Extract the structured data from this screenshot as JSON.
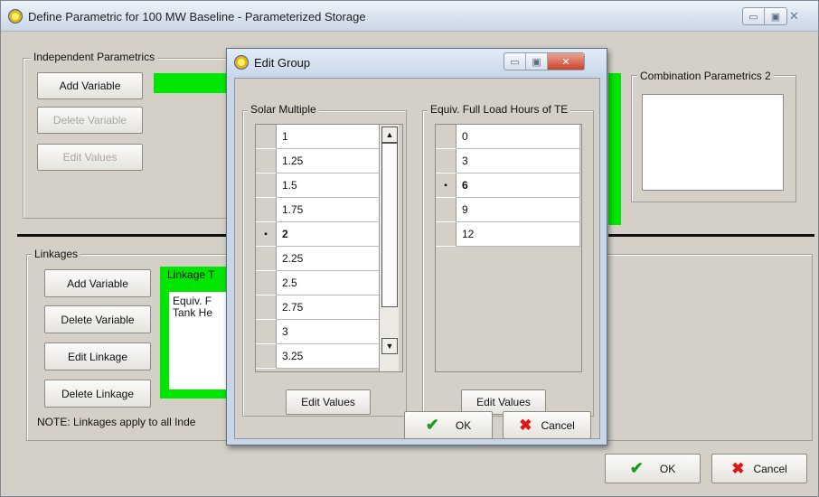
{
  "main_window": {
    "title": "Define Parametric for 100 MW Baseline - Parameterized Storage",
    "icon": "sun-app-icon",
    "independent": {
      "label": "Independent Parametrics",
      "add_variable": "Add Variable",
      "delete_variable": "Delete Variable",
      "edit_values": "Edit Values"
    },
    "combination_2_label": "Combination Parametrics 2",
    "linkages": {
      "label": "Linkages",
      "add_variable": "Add Variable",
      "delete_variable": "Delete Variable",
      "edit_linkage": "Edit Linkage",
      "delete_linkage": "Delete Linkage",
      "table_header": "Linkage T",
      "items": [
        "Equiv. F",
        "Tank He"
      ],
      "note": "NOTE: Linkages apply to all Inde"
    },
    "ok": "OK",
    "cancel": "Cancel"
  },
  "dialog": {
    "title": "Edit Group",
    "left_group": {
      "label": "Solar Multiple",
      "values": [
        "1",
        "1.25",
        "1.5",
        "1.75",
        "2",
        "2.25",
        "2.5",
        "2.75",
        "3",
        "3.25"
      ],
      "current_index": 4,
      "current_marker": "▪",
      "edit_values": "Edit Values"
    },
    "right_group": {
      "label": "Equiv. Full Load Hours of TE",
      "values": [
        "0",
        "3",
        "6",
        "9",
        "12"
      ],
      "current_index": 2,
      "current_marker": "▪",
      "edit_values": "Edit Values"
    },
    "ok": "OK",
    "cancel": "Cancel"
  },
  "colors": {
    "highlight_green": "#00e600",
    "ok_check": "#1e9b1e",
    "cancel_x": "#e01515",
    "close_button": "#c9412b"
  }
}
